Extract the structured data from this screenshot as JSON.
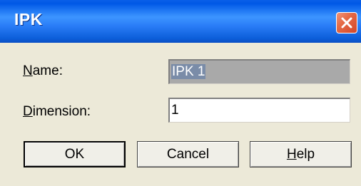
{
  "window": {
    "title": "IPK"
  },
  "form": {
    "name_label_mnemonic": "N",
    "name_label_rest": "ame:",
    "name_value": "IPK 1",
    "dimension_label_mnemonic": "D",
    "dimension_label_rest": "imension:",
    "dimension_value": "1"
  },
  "buttons": {
    "ok_label": "OK",
    "cancel_label": "Cancel",
    "help_mnemonic": "H",
    "help_rest": "elp"
  },
  "colors": {
    "titlebar": "#2a7df7",
    "dialog_bg": "#ece9d8",
    "close_button": "#e56a45"
  },
  "icons": {
    "close": "close-icon"
  }
}
